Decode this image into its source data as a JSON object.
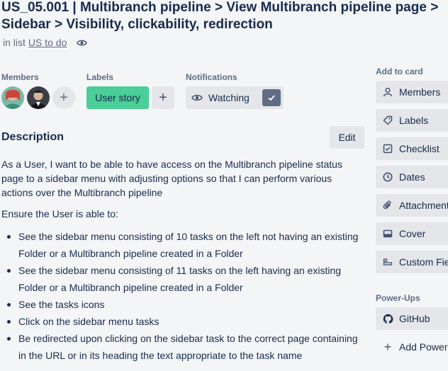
{
  "card": {
    "title": "US_05.001 | Multibranch pipeline > View Multibranch pipeline page > Sidebar > Visibility, clickability, redirection",
    "in_list_prefix": "in list",
    "list_name": "US to do"
  },
  "members": {
    "label": "Members"
  },
  "labels": {
    "label": "Labels",
    "items": [
      "User story"
    ],
    "label_color": "#4bce97"
  },
  "notifications": {
    "label": "Notifications",
    "button": "Watching"
  },
  "description": {
    "heading": "Description",
    "edit": "Edit",
    "paragraph1": "As a User, I want to be able to have access on the Multibranch pipeline status page to a sidebar menu with adjusting options so that I can perform various actions over the Multibranch pipeline",
    "paragraph2": "Ensure the User is able to:",
    "bullets": [
      "See the sidebar menu consisting of 10 tasks on the left not having an existing Folder or a Multibranch pipeline created in a Folder",
      "See the sidebar menu consisting of 11 tasks on the left having an existing Folder or a Multibranch pipeline created in a Folder",
      "See the tasks icons",
      "Click on the sidebar menu tasks",
      "Be redirected upon clicking on the sidebar task to the correct page containing in the URL or in its heading the text appropriate to the task name"
    ]
  },
  "sidebar": {
    "add_to_card_title": "Add to card",
    "add_to_card": [
      {
        "label": "Members",
        "icon": "person-icon"
      },
      {
        "label": "Labels",
        "icon": "tag-icon"
      },
      {
        "label": "Checklist",
        "icon": "checklist-icon"
      },
      {
        "label": "Dates",
        "icon": "clock-icon"
      },
      {
        "label": "Attachment",
        "icon": "paperclip-icon"
      },
      {
        "label": "Cover",
        "icon": "cover-icon"
      },
      {
        "label": "Custom Fie",
        "icon": "custom-fields-icon"
      }
    ],
    "powerups_title": "Power-Ups",
    "github": "GitHub",
    "add_powerups": "Add Power-"
  }
}
